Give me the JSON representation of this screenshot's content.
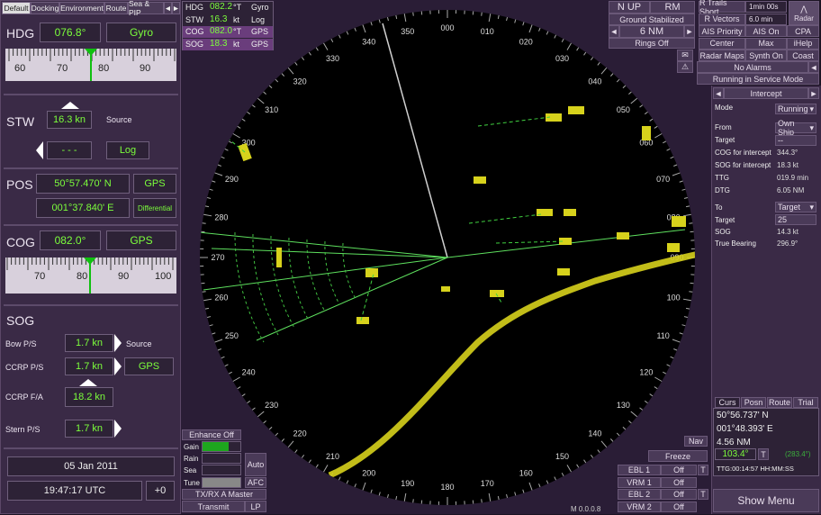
{
  "tabs": [
    "Default",
    "Docking",
    "Environment",
    "Route",
    "Sea & PIP"
  ],
  "hdg": {
    "label": "HDG",
    "value": "076.8°",
    "source": "Gyro",
    "scale": [
      "60",
      "70",
      "80",
      "90"
    ]
  },
  "stw": {
    "label": "STW",
    "value": "16.3 kn",
    "source_label": "Source",
    "dashes": "- - -",
    "source": "Log"
  },
  "pos": {
    "label": "POS",
    "lat": "50°57.470' N",
    "lon": "001°37.840' E",
    "src1": "GPS",
    "src2": "Differential"
  },
  "cog": {
    "label": "COG",
    "value": "082.0°",
    "source": "GPS",
    "scale": [
      "70",
      "80",
      "90",
      "100"
    ]
  },
  "sog": {
    "label": "SOG",
    "bow_label": "Bow P/S",
    "bow": "1.7 kn",
    "source_label": "Source",
    "ccrp_ps_label": "CCRP  P/S",
    "ccrp_ps": "1.7 kn",
    "source": "GPS",
    "ccrp_fa_label": "CCRP F/A",
    "ccrp_fa": "18.2 kn",
    "stern_label": "Stern P/S",
    "stern": "1.7 kn"
  },
  "date": "05 Jan 2011",
  "time": "19:47:17 UTC",
  "tz": "+0",
  "nav_rows": [
    {
      "k": "HDG",
      "v": "082.2",
      "u": "°T",
      "s": "Gyro"
    },
    {
      "k": "STW",
      "v": "16.3",
      "u": "kt",
      "s": "Log"
    },
    {
      "k": "COG",
      "v": "082.0",
      "u": "°T",
      "s": "GPS"
    },
    {
      "k": "SOG",
      "v": "18.3",
      "u": "kt",
      "s": "GPS"
    }
  ],
  "radar_top": {
    "nup": "N UP",
    "rm": "RM",
    "stab": "Ground Stabilized",
    "range": "6 NM",
    "rings": "Rings Off"
  },
  "right_grid": [
    [
      "R Trails Short",
      "1min 00s"
    ],
    [
      "R Vectors",
      "6.0 min"
    ],
    [
      "AIS Priority",
      "AIS On",
      "CPA"
    ],
    [
      "Center",
      "Max",
      "iHelp"
    ],
    [
      "Radar Maps",
      "Synth On",
      "Coast"
    ]
  ],
  "radar_tab": "Radar",
  "alarms": "No Alarms",
  "service": "Running in Service Mode",
  "intercept": {
    "title": "Intercept",
    "mode_label": "Mode",
    "mode": "Running",
    "from_label": "From",
    "from": "Own Ship",
    "target_label": "Target",
    "target": "--",
    "cog_label": "COG for intercept",
    "cog": "344.3°",
    "sog_label": "SOG for intercept",
    "sog": "18.3 kt",
    "ttg_label": "TTG",
    "ttg": "019.9 min",
    "dtg_label": "DTG",
    "dtg": "6.05 NM",
    "to_label": "To",
    "to": "Target",
    "target2_label": "Target",
    "target2": "25",
    "sog2_label": "SOG",
    "sog2": "14.3 kt",
    "tb_label": "True Bearing",
    "tb": "296.9°"
  },
  "cursor": {
    "tabs": [
      "Curs",
      "Posn",
      "Route",
      "Trial"
    ],
    "lat": "50°56.737' N",
    "lon": "001°48.393' E",
    "dist": "4.56 NM",
    "brg": "103.4°",
    "t": "T",
    "rel": "(283.4°)",
    "ttg": "TTG:00:14:57 HH:MM:SS"
  },
  "bottom_left": {
    "enhance": "Enhance Off",
    "gain": "Gain",
    "rain": "Rain",
    "sea": "Sea",
    "tune": "Tune",
    "auto": "Auto",
    "afc": "AFC",
    "tx": "TX/RX A Master",
    "transmit": "Transmit",
    "lp": "LP"
  },
  "ebl": [
    {
      "k": "EBL 1",
      "v": "Off"
    },
    {
      "k": "VRM 1",
      "v": "Off"
    },
    {
      "k": "EBL 2",
      "v": "Off"
    },
    {
      "k": "VRM 2",
      "v": "Off"
    }
  ],
  "nav_btn": "Nav",
  "freeze": "Freeze",
  "version": "M 0.0.0.8",
  "show_menu": "Show Menu",
  "bearings": [
    "000",
    "010",
    "020",
    "030",
    "040",
    "050",
    "060",
    "070",
    "080",
    "090",
    "100",
    "110",
    "120",
    "130",
    "140",
    "150",
    "160",
    "170",
    "180",
    "190",
    "200",
    "210",
    "220",
    "230",
    "240",
    "250",
    "260",
    "270",
    "280",
    "290",
    "300",
    "310",
    "320",
    "330",
    "340",
    "350"
  ],
  "colors": {
    "bg": "#1c1424",
    "panel": "#3a2a46",
    "value": "#7cff3c",
    "target": "#d7d21c",
    "scope": "#000000"
  }
}
